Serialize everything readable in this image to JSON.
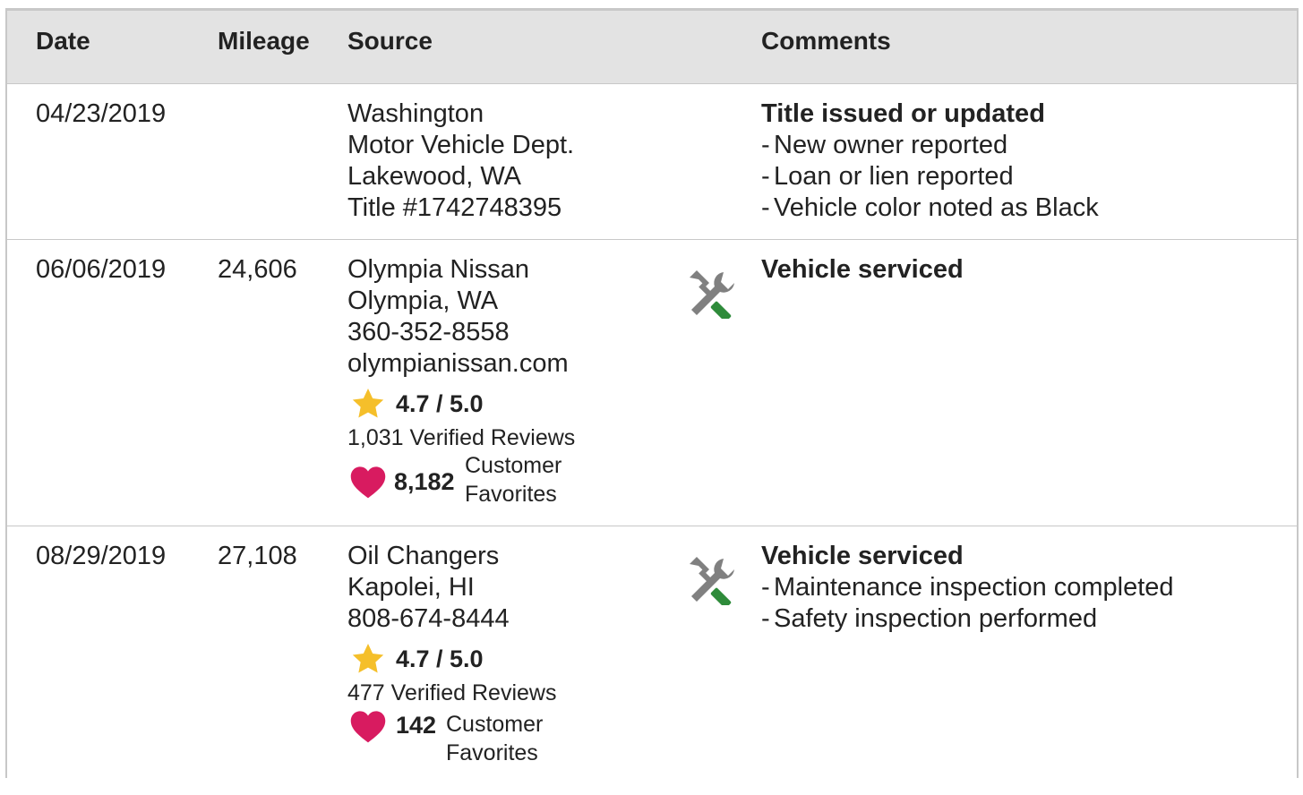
{
  "columns": {
    "date": "Date",
    "mileage": "Mileage",
    "source": "Source",
    "comments": "Comments"
  },
  "records": [
    {
      "date": "04/23/2019",
      "mileage": "",
      "source": [
        "Washington",
        "Motor Vehicle Dept.",
        "Lakewood, WA",
        "Title #1742748395"
      ],
      "comment_title": "Title issued or updated",
      "comment_items": [
        "New owner reported",
        "Loan or lien reported",
        "Vehicle color noted as Black"
      ]
    },
    {
      "date": "06/06/2019",
      "mileage": "24,606",
      "source": [
        "Olympia Nissan",
        "Olympia, WA",
        "360-352-8558",
        "olympianissan.com"
      ],
      "rating": "4.7 / 5.0",
      "reviews": "1,031 Verified Reviews",
      "favorites_count": "8,182",
      "favorites_label_1": "Customer",
      "favorites_label_2": "Favorites",
      "icon": "wrench-screwdriver-icon",
      "comment_title": "Vehicle serviced",
      "comment_items": []
    },
    {
      "date": "08/29/2019",
      "mileage": "27,108",
      "source": [
        "Oil Changers",
        "Kapolei, HI",
        "808-674-8444"
      ],
      "rating": "4.7 / 5.0",
      "reviews": "477 Verified Reviews",
      "favorites_count": "142",
      "favorites_label": "Customer Favorites",
      "icon": "wrench-screwdriver-icon",
      "comment_title": "Vehicle serviced",
      "comment_items": [
        "Maintenance inspection completed",
        "Safety inspection performed"
      ]
    }
  ],
  "colors": {
    "header_bg": "#e3e3e3",
    "border": "#c8c8c8",
    "star": "#f5bf2a",
    "heart": "#d81b60",
    "tool_gray": "#808080",
    "tool_green": "#2e8b3a"
  }
}
